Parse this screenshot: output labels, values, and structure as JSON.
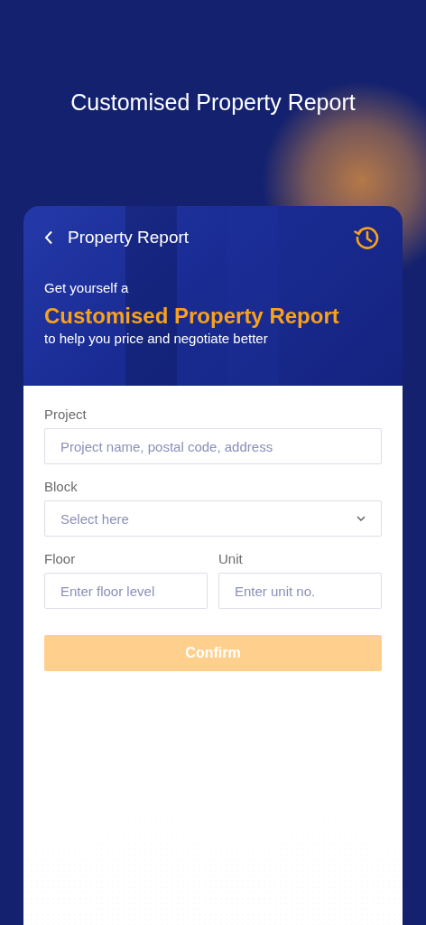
{
  "title": "Customised Property Report",
  "header": {
    "title": "Property Report",
    "intro": "Get yourself a",
    "headline": "Customised Property Report",
    "subtitle": "to help you price and negotiate better"
  },
  "form_rows": [
    [
      {
        "kind": "text",
        "label": "Project",
        "placeholder": "Project name, postal code, address"
      }
    ],
    [
      {
        "kind": "select",
        "label": "Block",
        "placeholder": "Select here"
      }
    ],
    [
      {
        "kind": "text",
        "label": "Floor",
        "placeholder": "Enter floor level"
      },
      {
        "kind": "text",
        "label": "Unit",
        "placeholder": "Enter unit no."
      }
    ]
  ],
  "confirm": {
    "label": "Confirm",
    "disabled": true
  }
}
